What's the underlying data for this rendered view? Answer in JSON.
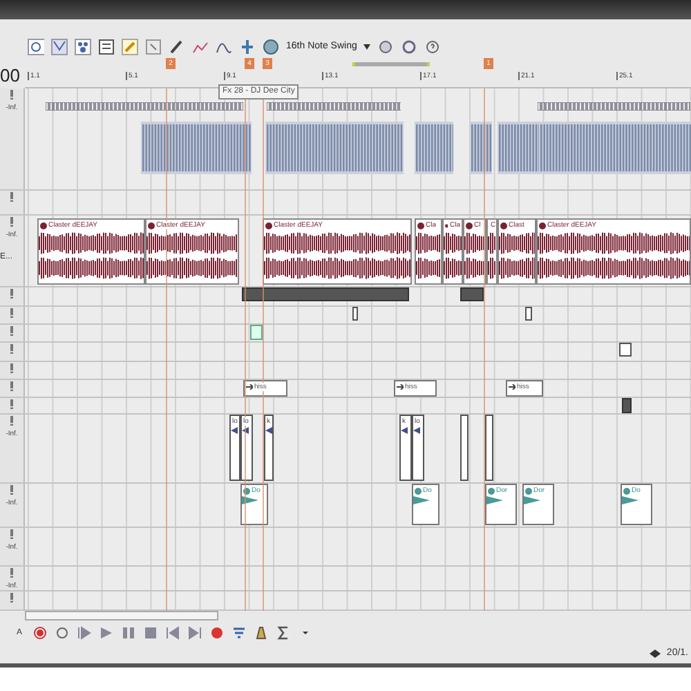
{
  "toolbar": {
    "swing": "16th Note Swing"
  },
  "header": {
    "time": "00"
  },
  "markers": [
    {
      "label": "2"
    },
    {
      "label": "4"
    },
    {
      "label": "3"
    },
    {
      "label": "1"
    }
  ],
  "ruler": [
    "1.1",
    "5.1",
    "9.1",
    "13.1",
    "17.1",
    "21.1",
    "25.1"
  ],
  "tooltip": "Fx 28 - DJ Dee City",
  "tracks": [
    {
      "kind": "midi",
      "volume": "-Inf."
    },
    {
      "kind": "plain"
    },
    {
      "kind": "audio",
      "volume": "-Inf.",
      "name": "E...",
      "clips": [
        {
          "label": "Claster dEEJAY"
        },
        {
          "label": "Claster dEEJAY"
        },
        {
          "label": "Claster dEEJAY"
        },
        {
          "label": "Cla"
        },
        {
          "label": "Cla"
        },
        {
          "label": "Cl"
        },
        {
          "label": "C"
        },
        {
          "label": "Clast"
        },
        {
          "label": "Claster dEEJAY"
        }
      ]
    },
    {
      "kind": "plain"
    },
    {
      "kind": "plain"
    },
    {
      "kind": "plain"
    },
    {
      "kind": "plain"
    },
    {
      "kind": "plain"
    },
    {
      "kind": "fx",
      "clips": [
        {
          "label": "hiss"
        },
        {
          "label": "hiss"
        },
        {
          "label": "hiss"
        }
      ]
    },
    {
      "kind": "plain"
    },
    {
      "kind": "drum",
      "volume": "-Inf.",
      "clips": [
        {
          "label": "lo"
        },
        {
          "label": "lo"
        },
        {
          "label": "k"
        },
        {
          "label": "k"
        },
        {
          "label": "lo"
        }
      ]
    },
    {
      "kind": "sample",
      "volume": "-Inf.",
      "clips": [
        {
          "label": "Do"
        },
        {
          "label": "Do"
        },
        {
          "label": "Dor"
        },
        {
          "label": "Dor"
        },
        {
          "label": "Do"
        }
      ]
    },
    {
      "kind": "plain",
      "volume": "-Inf."
    },
    {
      "kind": "plain",
      "volume": "-Inf."
    },
    {
      "kind": "plain"
    }
  ],
  "transport": {
    "channel": "A"
  },
  "status": {
    "position": "20/1."
  }
}
